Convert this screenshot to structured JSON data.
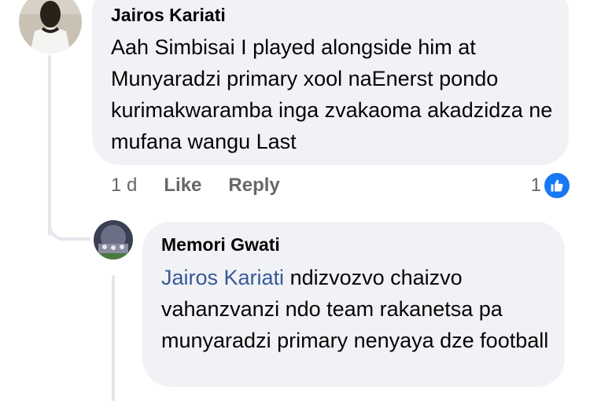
{
  "comment": {
    "author": "Jairos Kariati",
    "text": "Aah Simbisai I played alongside him at Munyaradzi primary xool naEnerst pondo kurimakwaramba inga zvakaoma akadzidza ne mufana wangu Last",
    "time": "1 d",
    "like_label": "Like",
    "reply_label": "Reply",
    "reaction_count": "1",
    "reaction_icon": "thumbs-up-icon"
  },
  "reply": {
    "author": "Memori Gwati",
    "mention": "Jairos Kariati",
    "text": " ndizvozvo chaizvo vahanzvanzi ndo team rakanetsa pa munyaradzi primary nenyaya dze football"
  },
  "colors": {
    "bubble": "#f0f2f5",
    "mention": "#385898",
    "like_blue": "#1877f2",
    "meta_gray": "#65676b"
  }
}
